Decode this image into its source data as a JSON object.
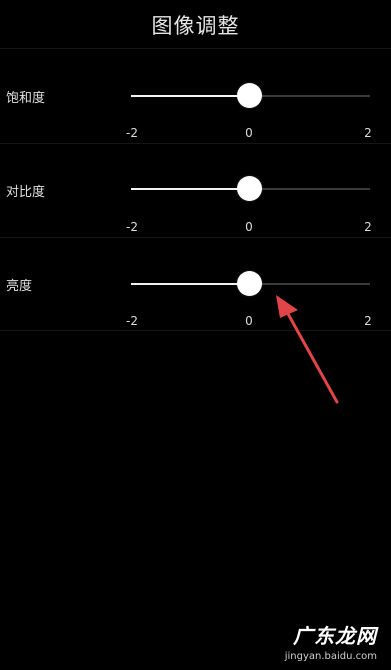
{
  "header": {
    "title": "图像调整"
  },
  "sliders": [
    {
      "label": "饱和度",
      "min_label": "-2",
      "mid_label": "0",
      "max_label": "2",
      "value": 0
    },
    {
      "label": "对比度",
      "min_label": "-2",
      "mid_label": "0",
      "max_label": "2",
      "value": 0
    },
    {
      "label": "亮度",
      "min_label": "-2",
      "mid_label": "0",
      "max_label": "2",
      "value": 0
    }
  ],
  "watermark": {
    "brand": "广东龙网",
    "url": "jingyan.baidu.com"
  },
  "colors": {
    "background": "#000000",
    "thumb": "#ffffff",
    "track_active": "#f2f2f2",
    "track_inactive": "#3a3a3a",
    "annotation_arrow": "#e0454a"
  }
}
